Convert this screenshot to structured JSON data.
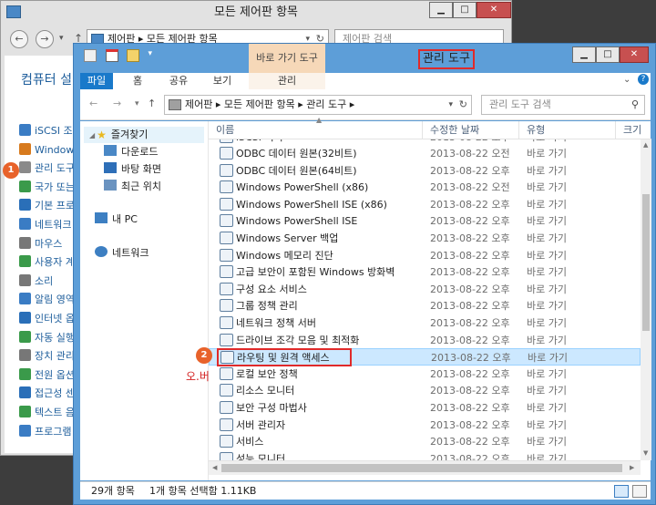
{
  "back_window": {
    "title": "모든 제어판 항목",
    "address": "제어판 ▸ 모든 제어판 항목",
    "search_placeholder": "제어판 검색",
    "heading": "컴퓨터 설",
    "items": [
      {
        "label": "iSCSI 조",
        "icon": "iscsi-icon",
        "color": "#3a7cc4"
      },
      {
        "label": "Windows",
        "icon": "windows-update-icon",
        "color": "#d77a1d"
      },
      {
        "label": "관리 도구",
        "icon": "admin-tools-icon",
        "color": "#8a8a8a"
      },
      {
        "label": "국가 또는",
        "icon": "region-icon",
        "color": "#3a9a4a"
      },
      {
        "label": "기본 프로",
        "icon": "default-programs-icon",
        "color": "#2a6fb8"
      },
      {
        "label": "네트워크",
        "icon": "network-center-icon",
        "color": "#3a7cc4"
      },
      {
        "label": "마우스",
        "icon": "mouse-icon",
        "color": "#777777"
      },
      {
        "label": "사용자 계",
        "icon": "user-accounts-icon",
        "color": "#3a9a4a"
      },
      {
        "label": "소리",
        "icon": "sound-icon",
        "color": "#777777"
      },
      {
        "label": "알림 영역",
        "icon": "notification-icon",
        "color": "#3a7cc4"
      },
      {
        "label": "인터넷 옵",
        "icon": "internet-options-icon",
        "color": "#2a6fb8"
      },
      {
        "label": "자동 실행",
        "icon": "autoplay-icon",
        "color": "#3a9a4a"
      },
      {
        "label": "장치 관리",
        "icon": "device-manager-icon",
        "color": "#777777"
      },
      {
        "label": "전원 옵션",
        "icon": "power-icon",
        "color": "#3a9a4a"
      },
      {
        "label": "접근성 센",
        "icon": "ease-of-access-icon",
        "color": "#2a6fb8"
      },
      {
        "label": "텍스트 음",
        "icon": "speech-icon",
        "color": "#3a9a4a"
      },
      {
        "label": "프로그램",
        "icon": "programs-icon",
        "color": "#3a7cc4"
      }
    ],
    "badge1": "1"
  },
  "front_window": {
    "ctx_tab": "바로 가기 도구",
    "ctx_subtab": "관리",
    "title": "관리 도구",
    "ribbon_tabs": [
      {
        "label": "파일",
        "active": true
      },
      {
        "label": "홈",
        "active": false
      },
      {
        "label": "공유",
        "active": false
      },
      {
        "label": "보기",
        "active": false
      }
    ],
    "address": "제어판 ▸ 모든 제어판 항목 ▸ 관리 도구 ▸",
    "search_placeholder": "관리 도구 검색",
    "nav": {
      "favorites": "즐겨찾기",
      "downloads": "다운로드",
      "desktop": "바탕 화면",
      "recent": "최근 위치",
      "mypc": "내 PC",
      "network": "네트워크"
    },
    "columns": {
      "name": "이름",
      "date": "수정한 날짜",
      "type": "유형",
      "size": "크기"
    },
    "partial_row": {
      "name": "iSCSI 이니",
      "date": "2013-08-22 오후",
      "type": "바로 가기"
    },
    "rows": [
      {
        "name": "ODBC 데이터 원본(32비트)",
        "date": "2013-08-22 오전",
        "type": "바로 가기"
      },
      {
        "name": "ODBC 데이터 원본(64비트)",
        "date": "2013-08-22 오후",
        "type": "바로 가기"
      },
      {
        "name": "Windows PowerShell (x86)",
        "date": "2013-08-22 오전",
        "type": "바로 가기"
      },
      {
        "name": "Windows PowerShell ISE (x86)",
        "date": "2013-08-22 오후",
        "type": "바로 가기"
      },
      {
        "name": "Windows PowerShell ISE",
        "date": "2013-08-22 오후",
        "type": "바로 가기"
      },
      {
        "name": "Windows Server 백업",
        "date": "2013-08-22 오후",
        "type": "바로 가기"
      },
      {
        "name": "Windows 메모리 진단",
        "date": "2013-08-22 오후",
        "type": "바로 가기"
      },
      {
        "name": "고급 보안이 포함된 Windows 방화벽",
        "date": "2013-08-22 오후",
        "type": "바로 가기"
      },
      {
        "name": "구성 요소 서비스",
        "date": "2013-08-22 오후",
        "type": "바로 가기"
      },
      {
        "name": "그룹 정책 관리",
        "date": "2013-08-22 오후",
        "type": "바로 가기"
      },
      {
        "name": "네트워크 정책 서버",
        "date": "2013-08-22 오후",
        "type": "바로 가기"
      },
      {
        "name": "드라이브 조각 모음 및 최적화",
        "date": "2013-08-22 오후",
        "type": "바로 가기"
      },
      {
        "name": "라우팅 및 원격 액세스",
        "date": "2013-08-22 오후",
        "type": "바로 가기",
        "selected": true
      },
      {
        "name": "로컬 보안 정책",
        "date": "2013-08-22 오후",
        "type": "바로 가기"
      },
      {
        "name": "리소스 모니터",
        "date": "2013-08-22 오후",
        "type": "바로 가기"
      },
      {
        "name": "보안 구성 마법사",
        "date": "2013-08-22 오후",
        "type": "바로 가기"
      },
      {
        "name": "서버 관리자",
        "date": "2013-08-22 오후",
        "type": "바로 가기"
      },
      {
        "name": "서비스",
        "date": "2013-08-22 오후",
        "type": "바로 가기"
      },
      {
        "name": "성능 모니터",
        "date": "2013-08-22 오후",
        "type": "바로 가기"
      }
    ],
    "badge2": "2",
    "annotation": "오.버",
    "status_count": "29개 항목",
    "status_selected": "1개 항목 선택함 1.11KB"
  }
}
